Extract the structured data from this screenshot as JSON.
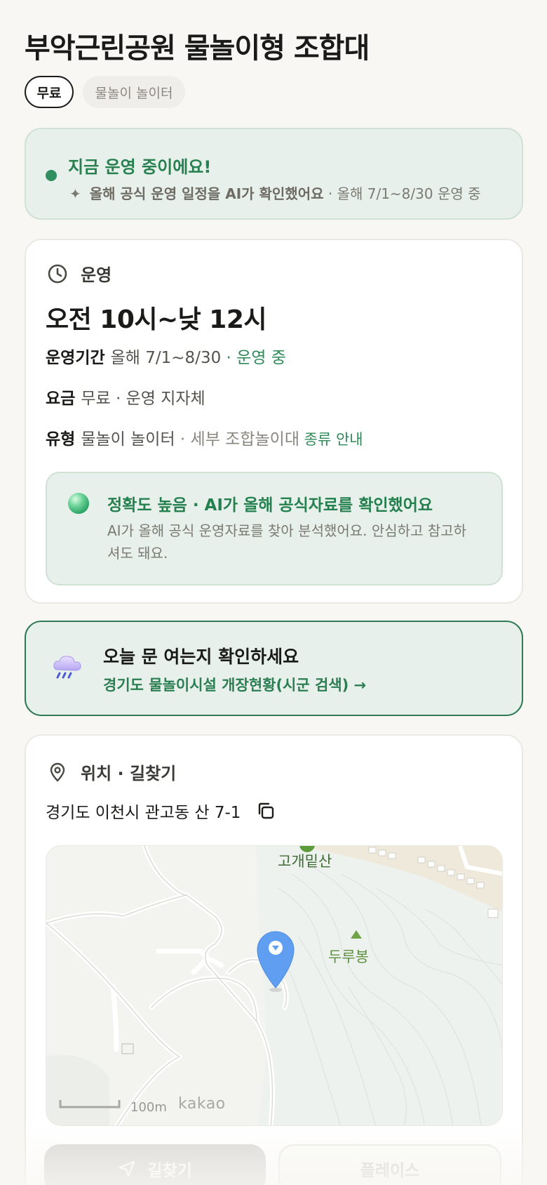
{
  "header": {
    "title": "부악근린공원 물놀이형 조합대",
    "chips": [
      "무료",
      "물놀이 놀이터"
    ]
  },
  "status": {
    "title": "지금 운영 중이에요!",
    "sparkle": "✦",
    "ai_note": "올해 공식 운영 일정을 AI가 확인했어요",
    "period": " · 올해 7/1~8/30 운영 중"
  },
  "operation": {
    "section_label": "운영",
    "time": "오전 10시~낮 12시",
    "period_key": "운영기간",
    "period_value": "올해 7/1~8/30",
    "period_status": " · 운영 중",
    "fee_key": "요금",
    "fee_value": "무료 · 운영 지자체",
    "type_key": "유형",
    "type_value": "물놀이 놀이터",
    "type_detail": " · 세부 조합놀이대",
    "type_link": " 종류 안내",
    "ai_box": {
      "title": "정확도 높음 · AI가 올해 공식자료를 확인했어요",
      "text": "AI가 올해 공식 운영자료를 찾아 분석했어요. 안심하고 참고하셔도 돼요."
    }
  },
  "today": {
    "title": "오늘 문 여는지 확인하세요",
    "link": "경기도 물놀이시설 개장현황(시군 검색) →"
  },
  "location": {
    "section_label": "위치 · 길찾기",
    "address": "경기도 이천시 관고동 산 7-1",
    "map": {
      "peak_labels": [
        "고개밑산",
        "두루봉"
      ],
      "scale": "100m",
      "brand": "kakao"
    }
  },
  "actions": {
    "directions_label": "길찾기",
    "place_label": "플레이스"
  }
}
